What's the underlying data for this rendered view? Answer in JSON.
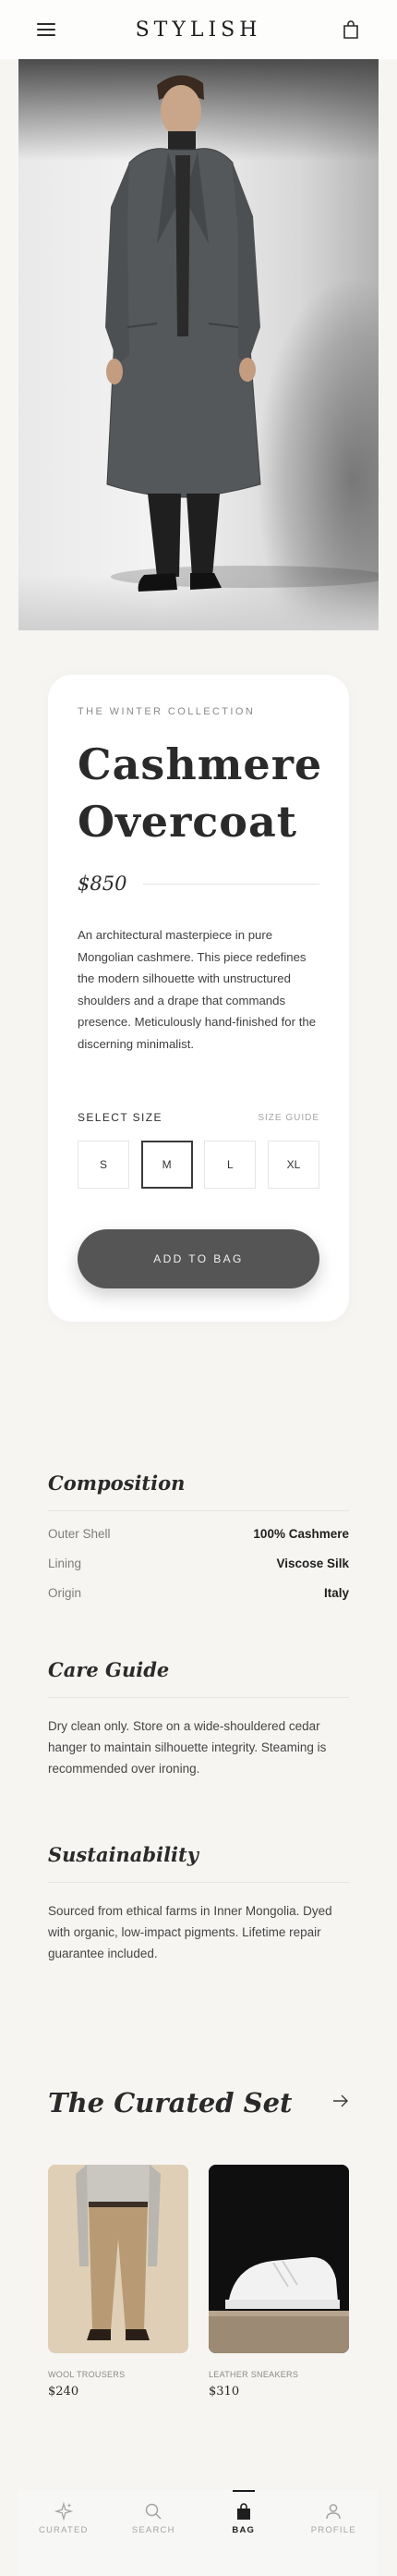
{
  "header": {
    "brand": "STYLISH"
  },
  "hero": {
    "image": "model-in-charcoal-overcoat"
  },
  "product": {
    "eyebrow": "THE WINTER COLLECTION",
    "title_line1": "Cashmere",
    "title_line2": "Overcoat",
    "price": "$850",
    "description": "An architectural masterpiece in pure Mongolian cashmere. This piece redefines the modern silhouette with unstructured shoulders and a drape that commands presence. Meticulously hand-finished for the discerning minimalist.",
    "size_label": "SELECT SIZE",
    "size_guide": "SIZE GUIDE",
    "sizes": [
      "S",
      "M",
      "L",
      "XL"
    ],
    "selected_size": "M",
    "add_to_bag": "ADD TO BAG"
  },
  "composition": {
    "title": "Composition",
    "rows": [
      {
        "label": "Outer Shell",
        "value": "100% Cashmere"
      },
      {
        "label": "Lining",
        "value": "Viscose Silk"
      },
      {
        "label": "Origin",
        "value": "Italy"
      }
    ]
  },
  "care": {
    "title": "Care Guide",
    "body": "Dry clean only. Store on a wide-shouldered cedar hanger to maintain silhouette integrity. Steaming is recommended over ironing."
  },
  "sustainability": {
    "title": "Sustainability",
    "body": "Sourced from ethical farms in Inner Mongolia. Dyed with organic, low-impact pigments. Lifetime repair guarantee included."
  },
  "curated": {
    "title": "The Curated Set",
    "items": [
      {
        "category": "WOOL TROUSERS",
        "price": "$240"
      },
      {
        "category": "LEATHER SNEAKERS",
        "price": "$310"
      }
    ]
  },
  "nav": {
    "items": [
      {
        "label": "CURATED",
        "icon": "sparkle-icon"
      },
      {
        "label": "SEARCH",
        "icon": "search-icon"
      },
      {
        "label": "BAG",
        "icon": "bag-icon"
      },
      {
        "label": "PROFILE",
        "icon": "person-icon"
      }
    ],
    "active": "BAG"
  },
  "colors": {
    "background": "#f6f5f2",
    "card": "#ffffff",
    "button": "#545554",
    "text": "#2a2a2a"
  }
}
